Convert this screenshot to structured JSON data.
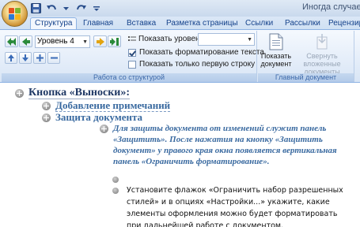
{
  "window": {
    "title": "Иногда случаетс"
  },
  "quick_access": {
    "icons": [
      "save-icon",
      "undo-icon",
      "redo-icon",
      "customize-icon"
    ]
  },
  "tabs": [
    {
      "label": "Структура",
      "active": true
    },
    {
      "label": "Главная",
      "active": false
    },
    {
      "label": "Вставка",
      "active": false
    },
    {
      "label": "Разметка страницы",
      "active": false
    },
    {
      "label": "Ссылки",
      "active": false
    },
    {
      "label": "Рассылки",
      "active": false
    },
    {
      "label": "Рецензир",
      "active": false
    }
  ],
  "ribbon": {
    "outline_group": {
      "level_value": "Уровень 4",
      "show_levels_label": "Показать уровень:",
      "show_levels_value": "",
      "show_formatting_label": "Показать форматирование текста",
      "show_formatting_checked": true,
      "first_line_label": "Показать только первую строку",
      "first_line_checked": false,
      "group_label": "Работа со структурой"
    },
    "master_group": {
      "show_document_label": "Показать документ",
      "collapse_label": "Свернуть вложенные документы",
      "group_label": "Главный документ"
    }
  },
  "document": {
    "heading1": "Кнопка «Выноски»:",
    "heading2_a": "Добавление примечаний",
    "heading2_b": "Защита документа",
    "italic_para": "Для защиты документа от изменений служит панель «Защитить». После нажатия на кнопку «Защитить документ» у правого края окна появляется вертикальная панель «Ограничить форматирование».",
    "body_para": "Установите флажок «Ограничить набор разрешенных стилей» и в опциях «Настройки...» укажите, какие элементы оформления можно будет форматировать при дальнейшей работе с документом."
  }
}
